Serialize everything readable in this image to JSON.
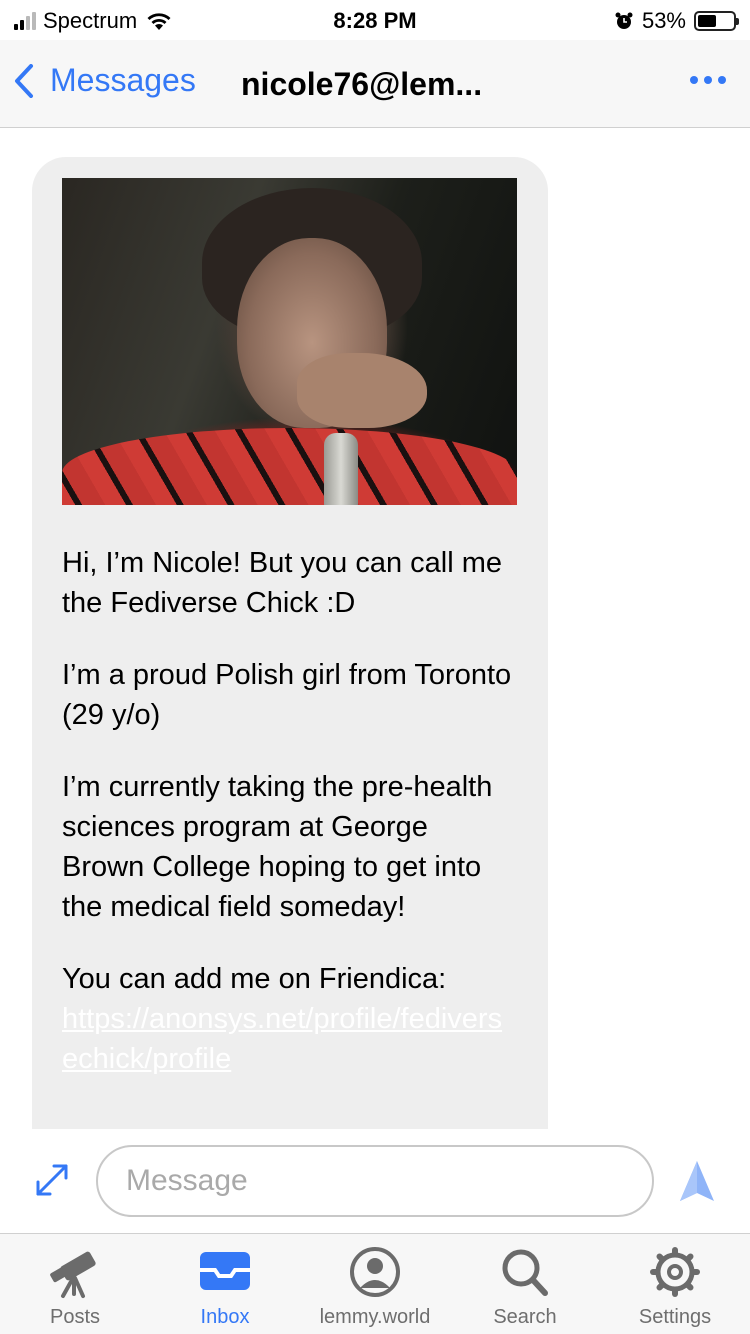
{
  "status_bar": {
    "carrier": "Spectrum",
    "time": "8:28 PM",
    "battery_percent": "53%",
    "battery_level": 0.53,
    "signal_bars": 2,
    "icons": [
      "signal-icon",
      "wifi-icon",
      "alarm-icon",
      "battery-icon"
    ]
  },
  "nav": {
    "back_label": "Messages",
    "title": "nicole76@lem...",
    "more_icon": "ellipsis-icon"
  },
  "message": {
    "paragraphs": [
      "Hi, I’m Nicole! But you can call me the Fediverse Chick :D",
      "I’m a proud Polish girl from Toronto (29 y/o)",
      "I’m currently taking the pre-health sciences program at George Brown College hoping to get into the medical field someday!"
    ],
    "friendica_prefix": "You can add me on Friendica:",
    "link": "https://anonsys.net/profile/fediversechick/profile"
  },
  "composer": {
    "placeholder": "Message",
    "expand_icon": "expand-icon",
    "send_icon": "send-icon"
  },
  "tabs": [
    {
      "label": "Posts",
      "icon": "telescope-icon"
    },
    {
      "label": "Inbox",
      "icon": "inbox-icon",
      "active": true
    },
    {
      "label": "lemmy.world",
      "icon": "profile-icon"
    },
    {
      "label": "Search",
      "icon": "search-icon"
    },
    {
      "label": "Settings",
      "icon": "gear-icon"
    }
  ],
  "colors": {
    "accent": "#3478f6",
    "bubble": "#eeeeee",
    "link": "#ffffff"
  }
}
